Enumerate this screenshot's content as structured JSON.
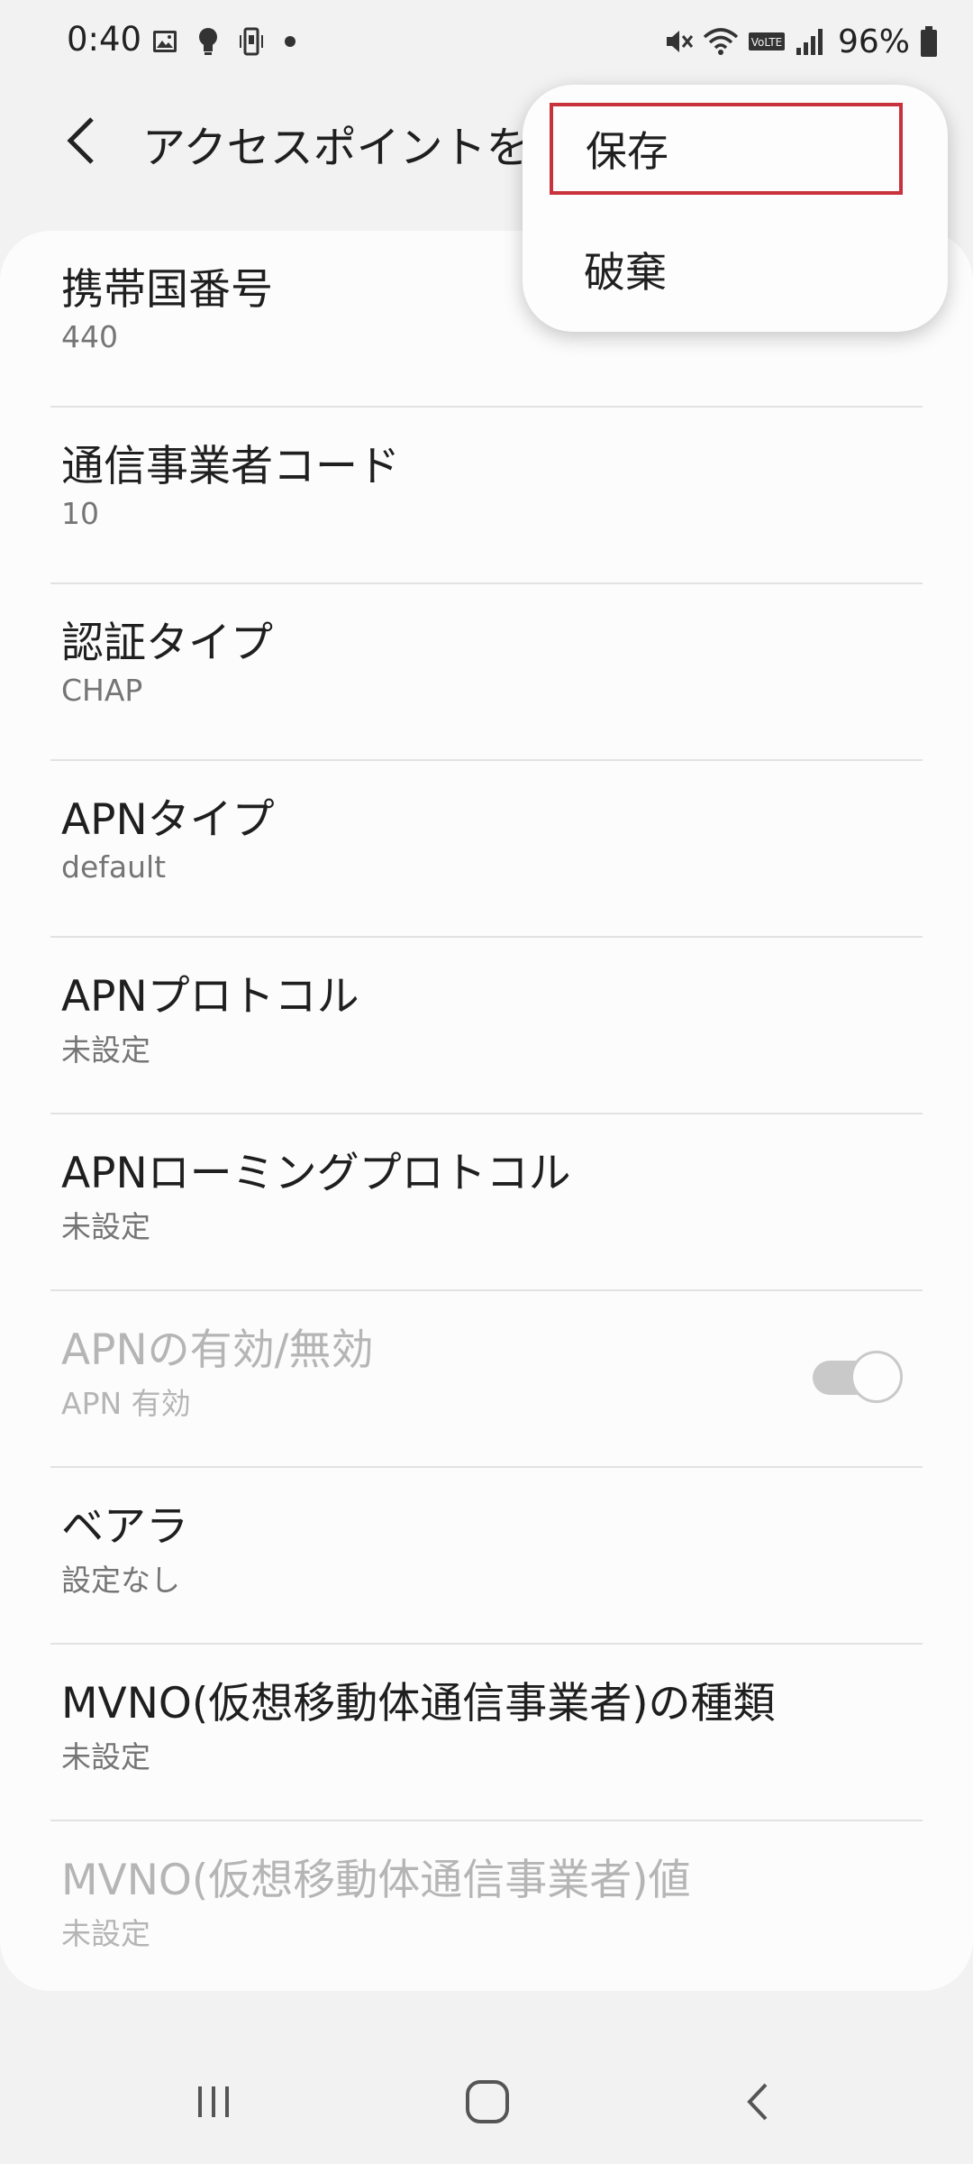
{
  "status_bar": {
    "time": "0:40",
    "battery": "96%",
    "left_icons": [
      "image-icon",
      "bulb-icon",
      "phone-vibrate-icon",
      "dot-icon"
    ],
    "right_icons": [
      "mute-icon",
      "wifi-icon",
      "volte-icon",
      "signal-icon",
      "battery-icon"
    ],
    "volte_label": "VoLTE"
  },
  "header": {
    "title": "アクセスポイントを編集"
  },
  "settings": [
    {
      "title": "携帯国番号",
      "value": "440",
      "enabled": true
    },
    {
      "title": "通信事業者コード",
      "value": "10",
      "enabled": true
    },
    {
      "title": "認証タイプ",
      "value": "CHAP",
      "enabled": true
    },
    {
      "title": "APNタイプ",
      "value": "default",
      "enabled": true
    },
    {
      "title": "APNプロトコル",
      "value": "未設定",
      "enabled": true
    },
    {
      "title": "APNローミングプロトコル",
      "value": "未設定",
      "enabled": true
    },
    {
      "title": "APNの有効/無効",
      "value": "APN 有効",
      "enabled": false,
      "toggle_on": true
    },
    {
      "title": "ベアラ",
      "value": "設定なし",
      "enabled": true
    },
    {
      "title": "MVNO(仮想移動体通信事業者)の種類",
      "value": "未設定",
      "enabled": true
    },
    {
      "title": "MVNO(仮想移動体通信事業者)値",
      "value": "未設定",
      "enabled": false
    }
  ],
  "menu": {
    "save": "保存",
    "discard": "破棄",
    "highlight_color": "#c8323c"
  },
  "nav_bar": {
    "recents": "recents-icon",
    "home": "home-icon",
    "back": "back-icon"
  }
}
